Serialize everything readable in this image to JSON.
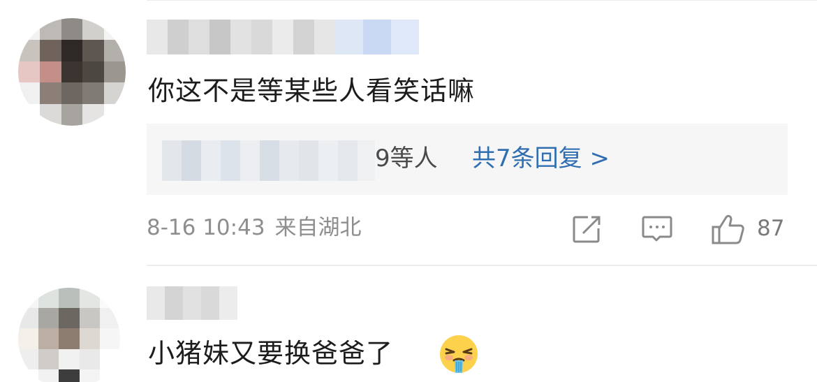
{
  "comments": [
    {
      "text": "你这不是等某些人看笑话嘛",
      "reply_preview": {
        "names_suffix": "9等人",
        "count_link": "共7条回复 >"
      },
      "date": "8-16 10:43",
      "location": "来自湖北",
      "likes": "87",
      "actions": [
        "share-icon",
        "comment-icon",
        "thumbs-up-icon"
      ]
    },
    {
      "text": "小猪妹又要换爸爸了",
      "emoji": "drooling-face-emoji"
    }
  ],
  "colors": {
    "link": "#2f6eb0",
    "meta": "#8e8e8e",
    "reply_bg": "#f6f6f6"
  }
}
